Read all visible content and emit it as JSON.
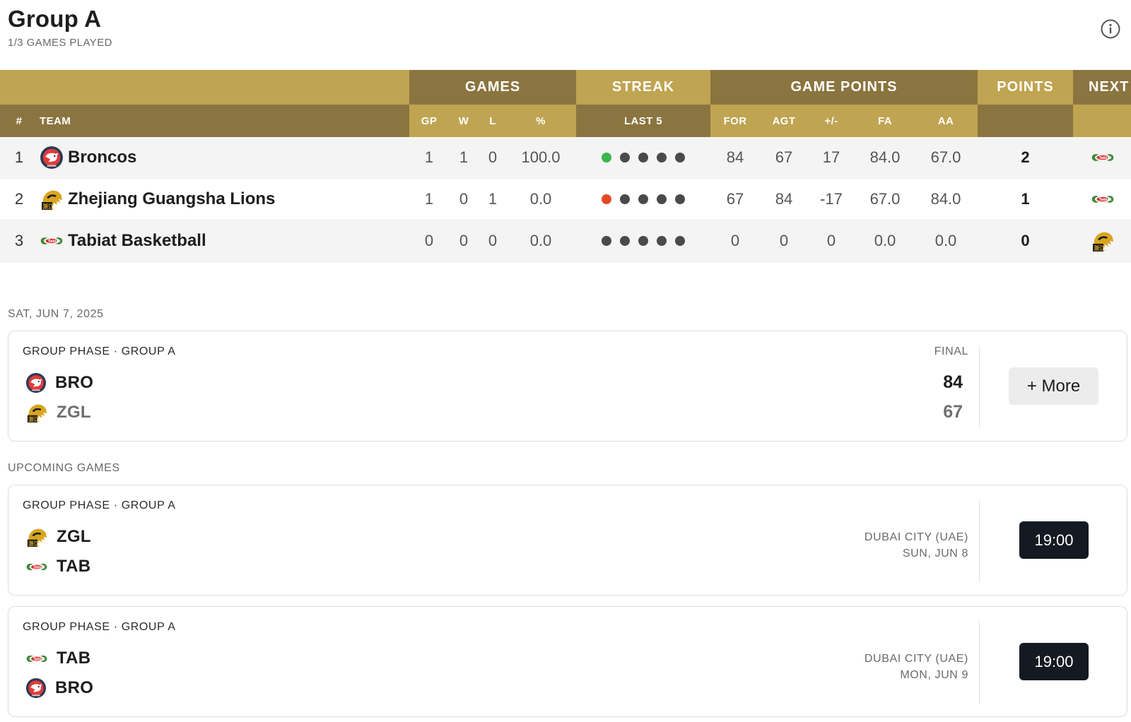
{
  "header": {
    "title": "Group A",
    "subtitle": "1/3 GAMES PLAYED",
    "info_icon": "info-icon"
  },
  "colors": {
    "gold": "#bfa452",
    "gold_dark": "#8a7540",
    "win": "#3cb54a",
    "loss": "#e24a25",
    "neutral": "#4a4a4a",
    "dark_button": "#151a22"
  },
  "table": {
    "groups": {
      "games": "GAMES",
      "streak": "STREAK",
      "game_points": "GAME POINTS",
      "points": "POINTS",
      "next": "NEXT"
    },
    "columns": {
      "rank": "#",
      "team": "TEAM",
      "gp": "GP",
      "w": "W",
      "l": "L",
      "pct": "%",
      "last5": "LAST 5",
      "for": "FOR",
      "agt": "AGT",
      "diff": "+/-",
      "fa": "FA",
      "aa": "AA"
    },
    "rows": [
      {
        "rank": "1",
        "team": "Broncos",
        "logo": "broncos-logo",
        "gp": "1",
        "w": "1",
        "l": "0",
        "pct": "100.0",
        "streak": [
          "win",
          "none",
          "none",
          "none",
          "none"
        ],
        "for": "84",
        "agt": "67",
        "diff": "17",
        "fa": "84.0",
        "aa": "67.0",
        "points": "2",
        "next": "tabiat-logo"
      },
      {
        "rank": "2",
        "team": "Zhejiang Guangsha Lions",
        "logo": "lions-logo",
        "gp": "1",
        "w": "0",
        "l": "1",
        "pct": "0.0",
        "streak": [
          "loss",
          "none",
          "none",
          "none",
          "none"
        ],
        "for": "67",
        "agt": "84",
        "diff": "-17",
        "fa": "67.0",
        "aa": "84.0",
        "points": "1",
        "next": "tabiat-logo"
      },
      {
        "rank": "3",
        "team": "Tabiat Basketball",
        "logo": "tabiat-logo",
        "gp": "0",
        "w": "0",
        "l": "0",
        "pct": "0.0",
        "streak": [
          "none",
          "none",
          "none",
          "none",
          "none"
        ],
        "for": "0",
        "agt": "0",
        "diff": "0",
        "fa": "0.0",
        "aa": "0.0",
        "points": "0",
        "next": "lions-logo"
      }
    ]
  },
  "results": {
    "date": "SAT, JUN 7, 2025",
    "game": {
      "phase": "GROUP PHASE · GROUP A",
      "status": "FINAL",
      "home": {
        "abbr": "BRO",
        "score": "84",
        "logo": "broncos-logo"
      },
      "away": {
        "abbr": "ZGL",
        "score": "67",
        "logo": "lions-logo"
      },
      "more_label": "+ More"
    }
  },
  "upcoming": {
    "label": "UPCOMING GAMES",
    "games": [
      {
        "phase": "GROUP PHASE · GROUP A",
        "home": {
          "abbr": "ZGL",
          "logo": "lions-logo"
        },
        "away": {
          "abbr": "TAB",
          "logo": "tabiat-logo"
        },
        "location": "DUBAI CITY (UAE)",
        "date": "SUN, JUN 8",
        "time": "19:00"
      },
      {
        "phase": "GROUP PHASE · GROUP A",
        "home": {
          "abbr": "TAB",
          "logo": "tabiat-logo"
        },
        "away": {
          "abbr": "BRO",
          "logo": "broncos-logo"
        },
        "location": "DUBAI CITY (UAE)",
        "date": "MON, JUN 9",
        "time": "19:00"
      }
    ]
  }
}
